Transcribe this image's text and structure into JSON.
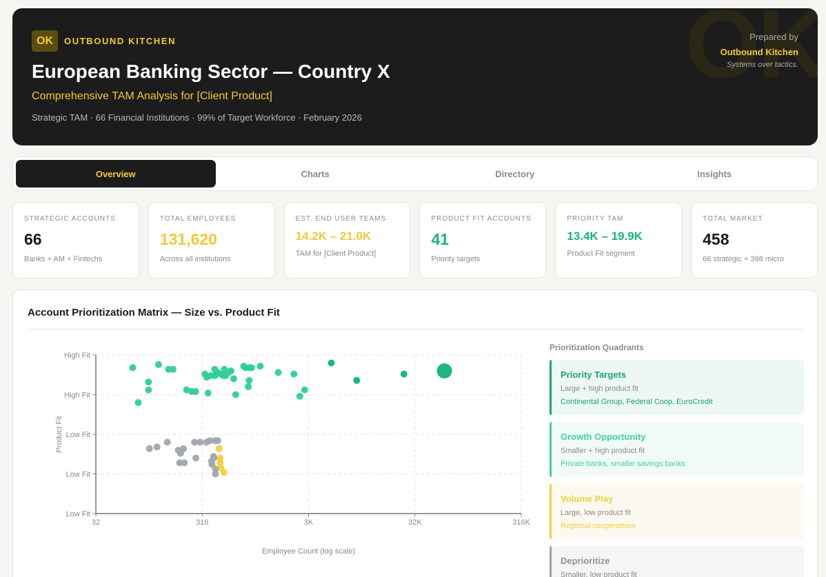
{
  "header": {
    "logo": "OK",
    "brand": "OUTBOUND KITCHEN",
    "watermark": "OK",
    "title": "European Banking Sector — Country X",
    "subtitle": "Comprehensive TAM Analysis for [Client Product]",
    "meta": "Strategic TAM · 66 Financial Institutions · 99% of Target Workforce · February 2026",
    "prepared_label": "Prepared by",
    "prepared_org": "Outbound Kitchen",
    "prepared_tagline": "Systems over tactics."
  },
  "tabs": [
    "Overview",
    "Charts",
    "Directory",
    "Insights"
  ],
  "kpis": [
    {
      "label": "STRATEGIC ACCOUNTS",
      "value": "66",
      "sub": "Banks + AM + Fintechs"
    },
    {
      "label": "TOTAL EMPLOYEES",
      "value": "131,620",
      "sub": "Across all institutions"
    },
    {
      "label": "EST. END USER TEAMS",
      "value": "14.2K – 21.0K",
      "sub": "TAM for [Client Product]"
    },
    {
      "label": "PRODUCT FIT ACCOUNTS",
      "value": "41",
      "sub": "Priority targets"
    },
    {
      "label": "PRIORITY TAM",
      "value": "13.4K – 19.9K",
      "sub": "Product Fit segment"
    },
    {
      "label": "TOTAL MARKET",
      "value": "458",
      "sub": "66 strategic + 398 micro"
    }
  ],
  "matrix": {
    "title": "Account Prioritization Matrix — Size vs. Product Fit",
    "quadrants_title": "Prioritization Quadrants",
    "quadrants": [
      {
        "name": "Priority Targets",
        "desc": "Large + high product fit",
        "examples": "Continental Group, Federal Coop, EuroCredit"
      },
      {
        "name": "Growth Opportunity",
        "desc": "Smaller + high product fit",
        "examples": "Private banks, smaller savings banks"
      },
      {
        "name": "Volume Play",
        "desc": "Large, low product fit",
        "examples": "Regional cooperatives"
      },
      {
        "name": "Deprioritize",
        "desc": "Smaller, low product fit",
        "examples": ""
      }
    ]
  },
  "chart_data": {
    "type": "scatter",
    "title": "",
    "xlabel": "Employee Count (log scale)",
    "ylabel": "Product Fit",
    "x_scale": "log",
    "x_ticks": [
      "32",
      "316",
      "3K",
      "32K",
      "316K"
    ],
    "y_ticks": [
      "High Fit",
      "High Fit",
      "Low Fit",
      "Low Fit",
      "Low Fit"
    ],
    "xlim": [
      32,
      316000
    ],
    "ylim": [
      0,
      1
    ],
    "grid": true,
    "colors": {
      "high": "#2ecf93",
      "large_high": "#14b07a",
      "volume": "#f2d03b",
      "deprioritize": "#a1a5ad"
    },
    "series": [
      {
        "name": "Priority Targets",
        "color": "#14b07a",
        "points": [
          [
            5200,
            0.95
          ],
          [
            9000,
            0.84
          ],
          [
            25000,
            0.88
          ],
          [
            60000,
            0.9,
            2.2
          ]
        ]
      },
      {
        "name": "Growth Opportunity",
        "color": "#2ecf93",
        "points": [
          [
            71,
            0.92
          ],
          [
            80,
            0.7
          ],
          [
            100,
            0.83
          ],
          [
            100,
            0.78
          ],
          [
            124,
            0.94
          ],
          [
            154,
            0.91
          ],
          [
            170,
            0.91
          ],
          [
            228,
            0.78
          ],
          [
            254,
            0.77
          ],
          [
            277,
            0.77
          ],
          [
            338,
            0.88
          ],
          [
            352,
            0.86
          ],
          [
            362,
            0.76
          ],
          [
            385,
            0.87
          ],
          [
            418,
            0.91
          ],
          [
            421,
            0.87
          ],
          [
            445,
            0.89
          ],
          [
            478,
            0.88
          ],
          [
            503,
            0.87
          ],
          [
            515,
            0.91
          ],
          [
            528,
            0.87
          ],
          [
            561,
            0.89
          ],
          [
            594,
            0.9
          ],
          [
            630,
            0.85
          ],
          [
            658,
            0.75
          ],
          [
            782,
            0.93
          ],
          [
            812,
            0.92
          ],
          [
            865,
            0.8
          ],
          [
            886,
            0.92
          ],
          [
            880,
            0.84
          ],
          [
            930,
            0.92
          ],
          [
            1120,
            0.93
          ],
          [
            1650,
            0.89
          ],
          [
            2320,
            0.88
          ],
          [
            2630,
            0.74
          ],
          [
            2920,
            0.78
          ]
        ]
      },
      {
        "name": "Volume Play",
        "color": "#f2d03b",
        "points": [
          [
            460,
            0.41
          ],
          [
            470,
            0.35
          ],
          [
            470,
            0.32
          ],
          [
            476,
            0.29
          ],
          [
            510,
            0.26
          ]
        ]
      },
      {
        "name": "Deprioritize",
        "color": "#a1a5ad",
        "points": [
          [
            102,
            0.41
          ],
          [
            120,
            0.42
          ],
          [
            150,
            0.45
          ],
          [
            190,
            0.4
          ],
          [
            200,
            0.38
          ],
          [
            213,
            0.41
          ],
          [
            196,
            0.32
          ],
          [
            217,
            0.32
          ],
          [
            270,
            0.45
          ],
          [
            278,
            0.35
          ],
          [
            305,
            0.45
          ],
          [
            350,
            0.45
          ],
          [
            375,
            0.46
          ],
          [
            390,
            0.33
          ],
          [
            394,
            0.31
          ],
          [
            408,
            0.36
          ],
          [
            410,
            0.35
          ],
          [
            422,
            0.46
          ],
          [
            425,
            0.28
          ],
          [
            425,
            0.25
          ],
          [
            447,
            0.46
          ]
        ]
      }
    ]
  }
}
